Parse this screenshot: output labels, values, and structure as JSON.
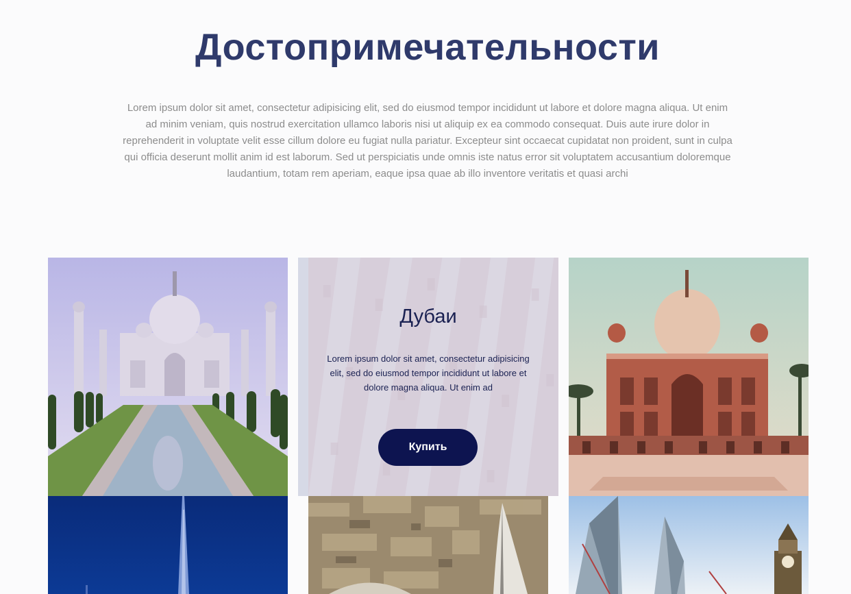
{
  "section": {
    "title": "Достопримечательности",
    "intro": "Lorem ipsum dolor sit amet, consectetur adipisicing elit, sed do eiusmod tempor incididunt ut labore et dolore magna aliqua. Ut enim ad minim veniam, quis nostrud exercitation ullamco laboris nisi ut aliquip ex ea commodo consequat. Duis aute irure dolor in reprehenderit in voluptate velit esse cillum dolore eu fugiat nulla pariatur. Excepteur sint occaecat cupidatat non proident, sunt in culpa qui officia deserunt mollit anim id est laborum. Sed ut perspiciatis unde omnis iste natus error sit voluptatem accusantium doloremque laudantium, totam rem aperiam, eaque ipsa quae ab illo inventore veritatis et quasi archi"
  },
  "featured_card": {
    "title": "Дубаи",
    "text": "Lorem ipsum dolor sit amet, consectetur adipisicing elit, sed do eiusmod tempor incididunt ut labore et dolore magna aliqua. Ut enim ad",
    "button_label": "Купить"
  },
  "colors": {
    "title": "#2f3a6b",
    "button": "#0d1450",
    "card_overlay": "#d6d9e6"
  }
}
